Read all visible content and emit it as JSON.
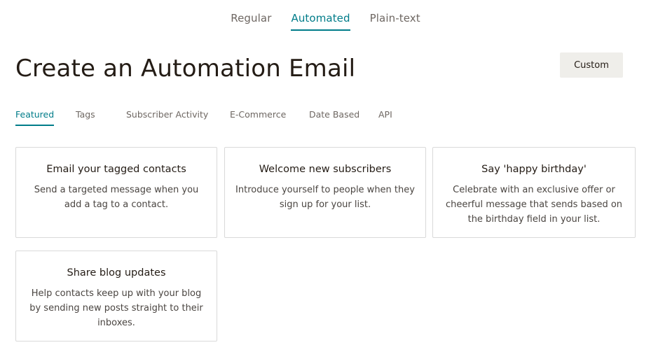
{
  "type_tabs": [
    {
      "label": "Regular",
      "active": false
    },
    {
      "label": "Automated",
      "active": true
    },
    {
      "label": "Plain-text",
      "active": false
    }
  ],
  "title": "Create an Automation Email",
  "custom_button": "Custom",
  "category_tabs": [
    {
      "label": "Featured",
      "active": true
    },
    {
      "label": "Tags",
      "active": false
    },
    {
      "label": "Subscriber Activity",
      "active": false
    },
    {
      "label": "E-Commerce",
      "active": false
    },
    {
      "label": "Date Based",
      "active": false
    },
    {
      "label": "API",
      "active": false
    }
  ],
  "cards": [
    {
      "title": "Email your tagged contacts",
      "description": "Send a targeted message when you add a tag to a contact."
    },
    {
      "title": "Welcome new subscribers",
      "description": "Introduce yourself to people when they sign up for your list."
    },
    {
      "title": "Say 'happy birthday'",
      "description": "Celebrate with an exclusive offer or cheerful message that sends based on the birthday field in your list."
    },
    {
      "title": "Share blog updates",
      "description": "Help contacts keep up with your blog by sending new posts straight to their inboxes."
    }
  ],
  "colors": {
    "accent": "#007c89",
    "text": "#241c15",
    "muted": "#6e6762",
    "button_bg": "#efeeea",
    "border": "#d9d9d9"
  }
}
